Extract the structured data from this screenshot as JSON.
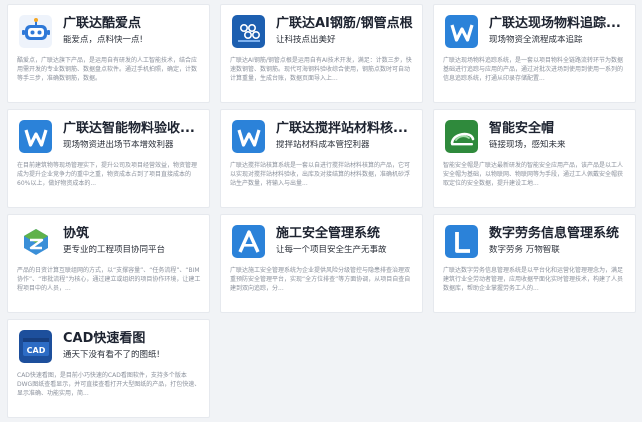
{
  "cards": [
    {
      "title": "广联达酷爱点",
      "subtitle": "能爱点，点料快一点!",
      "description": "酷爱点，广联达旗下产品，是运用自有研发的人工智能技术，结合应用需开发的专业数钢筋、数据盘点软件。通过手机拍照，确定，计数等手三步，准确数钢筋，数据。",
      "icon": "robot-icon"
    },
    {
      "title": "广联达AI钢筋/钢管点根",
      "subtitle": "让科技点出美好",
      "description": "广联达AI钢筋/钢管点根是运用自有AI技术开发，满足：计数三步，快速数钢管、数钢筋。现代可海钢料验收综合使用，钢筋点数时可自动计算重量，生成台账，数据页面导入上...",
      "icon": "rebar-icon"
    },
    {
      "title": "广联达现场物料追踪...",
      "subtitle": "现场物资全流程成本追踪",
      "description": "广联达现场物料追踪系统，是一套以项目物料全链路流转环节为数据基础进行追踪与应用的产品，通过对批次进场到使用到使用一系列的信息追踪系统，打通从印录存储配置...",
      "icon": "w-logo-icon"
    },
    {
      "title": "广联达智能物料验收...",
      "subtitle": "现场物资进出场节本增效利器",
      "description": "在目前建筑物等现场管理实下，提升公司及项目经营效益，物资管理成为提升企业竞争力的重中之重，物资成本占到了项目直接成本的60%以上，做好物资成本的...",
      "icon": "w-logo-icon"
    },
    {
      "title": "广联达搅拌站材料核...",
      "subtitle": "搅拌站材料成本管控利器",
      "description": "广联达搅拌站核算系统是一套以自进行搅拌站材料核算的产品，它可以实现对搅拌站材料验收，出库及对接结算的材料数据，准确机砂浮站生产数量，将输入与出量...",
      "icon": "w-logo-icon"
    },
    {
      "title": "智能安全帽",
      "subtitle": "链接现场，感知未来",
      "description": "智能安全帽是广联达最新研发的智能安全应用产品，该产品是以工人安全帽为基础，以物联网、物联网等为手段，通过工人佩戴安全帽获取定位的安全数据，提升建设工地...",
      "icon": "helmet-icon"
    },
    {
      "title": "协筑",
      "subtitle": "更专业的工程项目协同平台",
      "description": "严品的日资计算互联组网的方式，以“支撑容量”、“任务流程”、“BIM协作”、“审批流程”为核心，通过建立或组织的项目协作环境，让建工程项目中的人员，...",
      "icon": "xiezhu-icon"
    },
    {
      "title": "施工安全管理系统",
      "subtitle": "让每一个项目安全生产无事故",
      "description": "广联达施工安全管理系统为企业提供风险分级管控与隐患排查治理双重预防安全管理平台，实现“全方位排查”等方面协调，从项目自查自建到双向追踪，分...",
      "icon": "a-logo-icon"
    },
    {
      "title": "数字劳务信息管理系统",
      "subtitle": "数字劳务 万物智联",
      "description": "广联达数字劳务信息管理系统是以平台化和运营化管理理念为，满足建筑行业全劳动者管理，应用收据平面化实时管理技术，构建了人员数据库，帮助企业掌握劳务工人的...",
      "icon": "l-logo-icon"
    },
    {
      "title": "CAD快速看图",
      "subtitle": "通天下没有看不了的图纸!",
      "description": "CAD快速看图，是目前小巧快速的CAD看图软件，支持多个版本DWG图纸查看显示，并可直接查看打开大型图纸的产品，打包快速、显示准确、功能实用，简...",
      "icon": "cad-icon"
    }
  ],
  "colors": {
    "background": "#f1f3f6",
    "card": "#ffffff",
    "blue": "#1f6fd1",
    "green": "#3aa64a"
  }
}
